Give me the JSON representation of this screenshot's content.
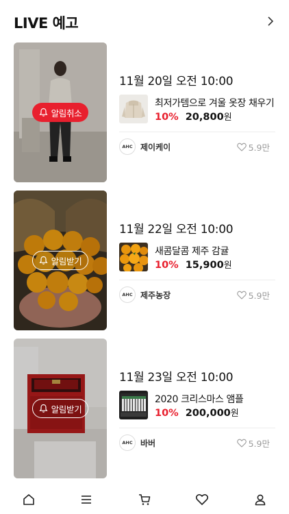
{
  "header": {
    "title": "LIVE 예고"
  },
  "broadcasts": [
    {
      "notify_label": "알림취소",
      "notify_state": "active",
      "date": "11월 20일 오전 10:00",
      "product_name": "최저가템으로 겨울 옷장 채우기",
      "discount": "10%",
      "price": "20,800",
      "currency": "원",
      "brand_logo_text": "AHC",
      "brand_name": "제이케이",
      "likes": "5.9만"
    },
    {
      "notify_label": "알림받기",
      "notify_state": "inactive",
      "date": "11월 22일 오전 10:00",
      "product_name": "새콤달콤 제주 감귤",
      "discount": "10%",
      "price": "15,900",
      "currency": "원",
      "brand_logo_text": "AHC",
      "brand_name": "제주농장",
      "likes": "5.9만"
    },
    {
      "notify_label": "알림받기",
      "notify_state": "inactive",
      "date": "11월 23일 오전 10:00",
      "product_name": "2020 크리스마스 앰플",
      "discount": "10%",
      "price": "200,000",
      "currency": "원",
      "brand_logo_text": "AHC",
      "brand_name": "바버",
      "likes": "5.9만"
    }
  ],
  "bottom_nav": {
    "items": [
      {
        "name": "home",
        "icon": "home-icon"
      },
      {
        "name": "menu",
        "icon": "menu-icon"
      },
      {
        "name": "cart",
        "icon": "cart-icon"
      },
      {
        "name": "wishlist",
        "icon": "heart-icon"
      },
      {
        "name": "mypage",
        "icon": "user-icon"
      }
    ]
  },
  "colors": {
    "accent": "#e8202e",
    "text": "#111111",
    "muted": "#9a9a9a"
  }
}
